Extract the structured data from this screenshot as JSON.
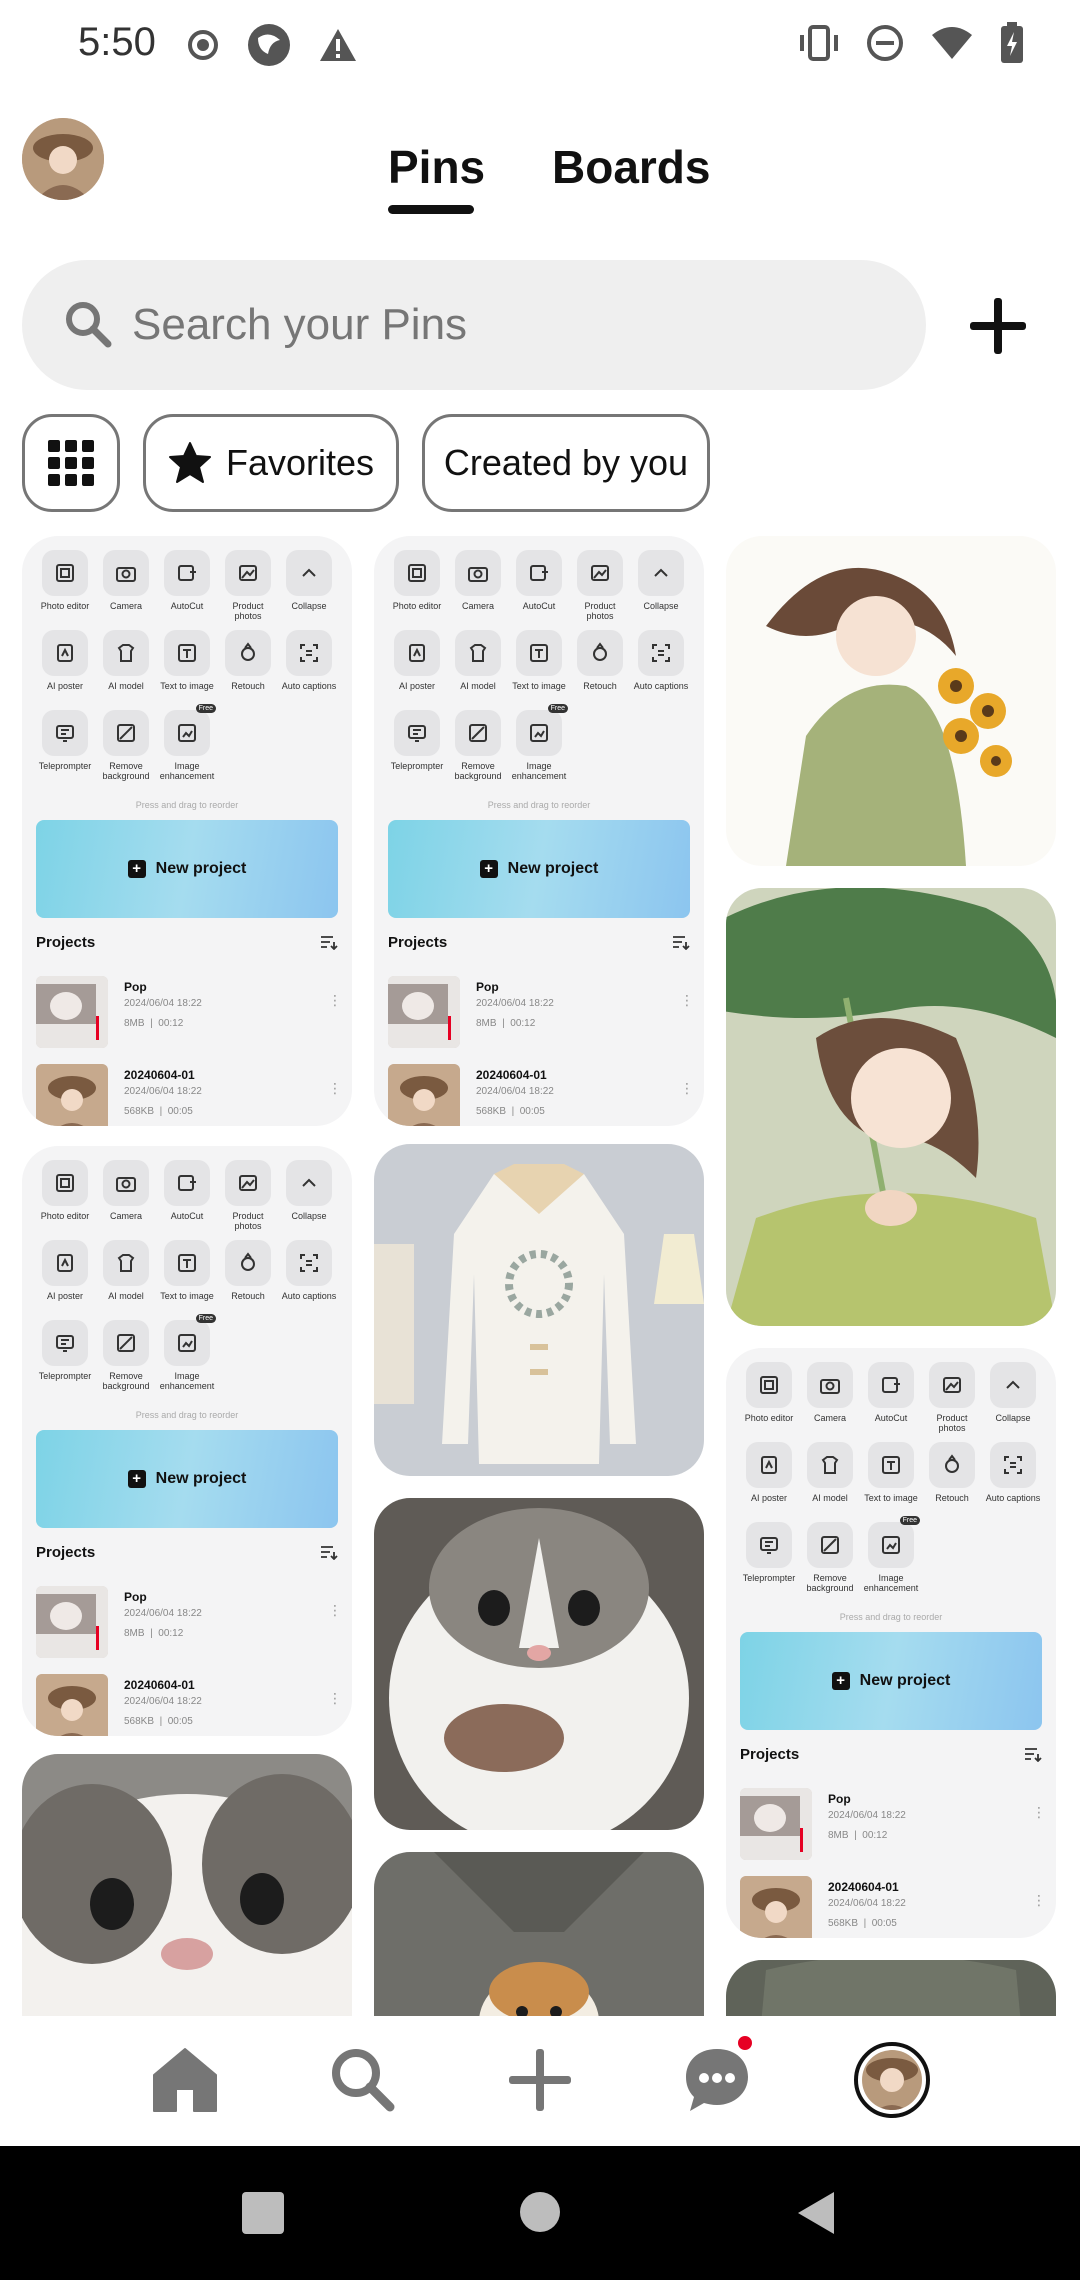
{
  "status_bar": {
    "time": "5:50",
    "left_icons": [
      "record-icon",
      "app-icon",
      "warning-icon"
    ],
    "right_icons": [
      "vibrate-icon",
      "dnd-icon",
      "wifi-icon",
      "battery-charging-icon"
    ]
  },
  "header": {
    "tabs": [
      {
        "label": "Pins",
        "active": true
      },
      {
        "label": "Boards",
        "active": false
      }
    ]
  },
  "search": {
    "placeholder": "Search your Pins",
    "value": ""
  },
  "filters": {
    "grid_icon": "grid-icon",
    "chips": [
      {
        "label": "Favorites",
        "icon": "star-icon"
      },
      {
        "label": "Created by you"
      }
    ]
  },
  "editor_card": {
    "tools": [
      "Photo editor",
      "Camera",
      "AutoCut",
      "Product photos",
      "Collapse",
      "AI poster",
      "AI model",
      "Text to image",
      "Retouch",
      "Auto captions",
      "Teleprompter",
      "Remove background",
      "Image enhancement"
    ],
    "free_badge": "Free",
    "hint": "Press and drag to reorder",
    "new_project": "New project",
    "projects_title": "Projects",
    "projects": [
      {
        "name": "Pop",
        "date": "2024/06/04 18:22",
        "size": "8MB",
        "duration": "00:12"
      },
      {
        "name": "20240604-01",
        "date": "2024/06/04 18:22",
        "size": "568KB",
        "duration": "00:05"
      }
    ]
  },
  "bottom_nav": {
    "items": [
      "home-icon",
      "search-icon",
      "create-icon",
      "messages-icon",
      "profile-avatar"
    ],
    "notification_color": "#e60023"
  },
  "colors": {
    "accent": "#111111",
    "search_bg": "#efefef",
    "chip_border": "#767676"
  }
}
